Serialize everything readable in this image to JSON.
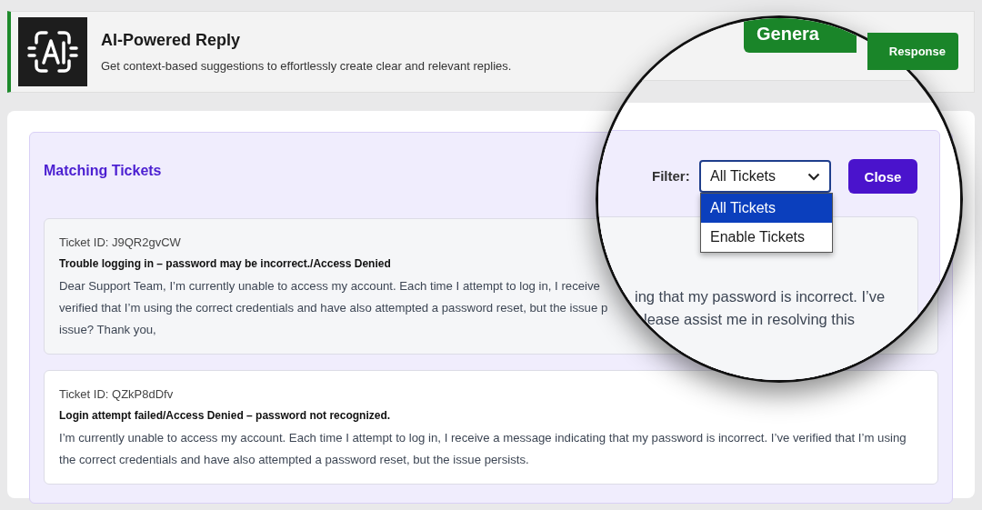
{
  "header": {
    "title": "AI-Powered Reply",
    "subtitle": "Get context-based suggestions to effortlessly create clear and relevant replies.",
    "button": {
      "label": "Response"
    }
  },
  "panel": {
    "title": "Matching Tickets",
    "tickets": [
      {
        "id_label": "Ticket ID: J9QR2gvCW",
        "subject": "Trouble logging in – password may be incorrect./Access Denied",
        "body_lines": [
          "Dear Support Team, I’m currently unable to access my account. Each time I attempt to log in, I receive",
          "verified that I’m using the correct credentials and have also attempted a password reset, but the issue p",
          "issue? Thank you,"
        ]
      },
      {
        "id_label": "Ticket ID: QZkP8dDfv",
        "subject": "Login attempt failed/Access Denied – password not recognized.",
        "body_lines": [
          "I’m currently unable to access my account. Each time I attempt to log in, I receive a message indicating that my password is incorrect. I’ve verified that I’m using the correct credentials and have also attempted a password reset, but the issue persists."
        ]
      }
    ]
  },
  "magnifier": {
    "header_button": {
      "label": "Genera"
    },
    "filter": {
      "label": "Filter:",
      "value": "All Tickets",
      "options": [
        {
          "label": "All Tickets",
          "selected": true
        },
        {
          "label": "Enable Tickets",
          "selected": false
        }
      ]
    },
    "close_button": {
      "label": "Close"
    },
    "ticket_text_lines": [
      "ing that my password is incorrect. I’ve",
      "lease assist me in resolving this"
    ]
  }
}
